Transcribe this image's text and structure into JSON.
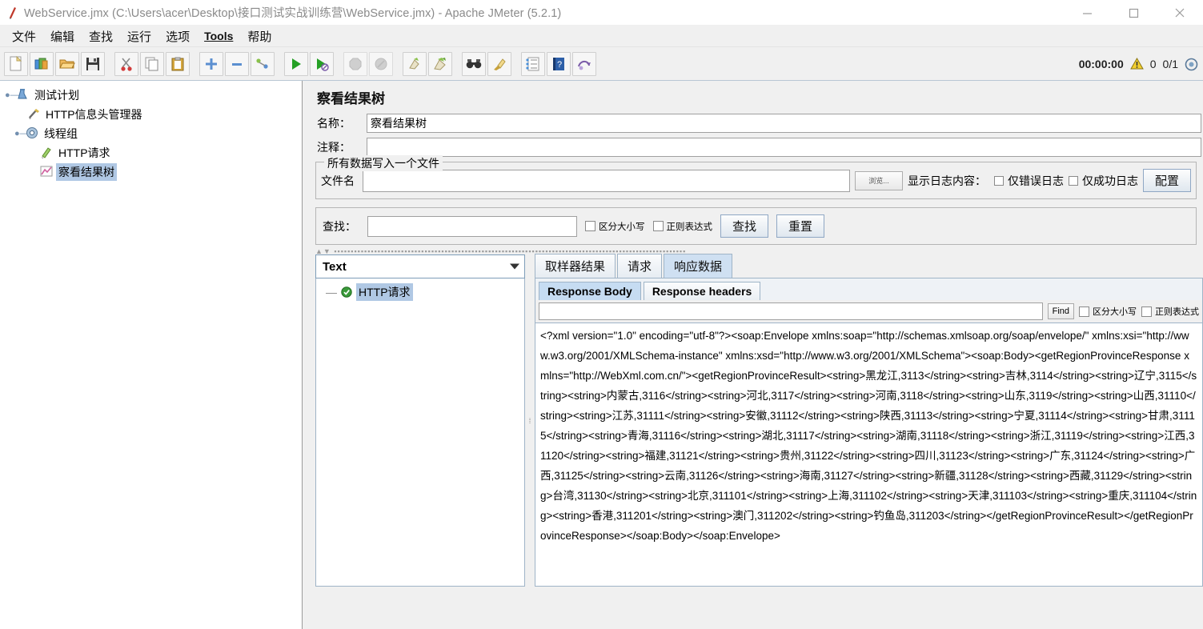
{
  "window": {
    "title": "WebService.jmx (C:\\Users\\acer\\Desktop\\接口测试实战训练营\\WebService.jmx) - Apache JMeter (5.2.1)",
    "app_icon": "jmeter-feather-icon",
    "minimize": "—",
    "maximize": "□",
    "close": "✕"
  },
  "menubar": {
    "items": [
      {
        "label": "文件",
        "underlined": false
      },
      {
        "label": "编辑",
        "underlined": false
      },
      {
        "label": "查找",
        "underlined": false
      },
      {
        "label": "运行",
        "underlined": false
      },
      {
        "label": "选项",
        "underlined": false
      },
      {
        "label": "Tools",
        "underlined": true
      },
      {
        "label": "帮助",
        "underlined": false
      }
    ]
  },
  "toolbar": {
    "buttons": [
      {
        "name": "new-icon"
      },
      {
        "name": "templates-icon"
      },
      {
        "name": "open-icon"
      },
      {
        "name": "save-icon"
      },
      {
        "name": "cut-icon"
      },
      {
        "name": "copy-icon"
      },
      {
        "name": "paste-icon"
      },
      {
        "name": "expand-all-icon"
      },
      {
        "name": "collapse-all-icon"
      },
      {
        "name": "toggle-icon"
      },
      {
        "name": "start-icon"
      },
      {
        "name": "start-no-pauses-icon"
      },
      {
        "name": "stop-icon"
      },
      {
        "name": "shutdown-icon"
      },
      {
        "name": "clear-icon"
      },
      {
        "name": "clear-all-icon"
      },
      {
        "name": "search-icon"
      },
      {
        "name": "search-reset-icon"
      },
      {
        "name": "function-helper-icon"
      },
      {
        "name": "help-icon"
      },
      {
        "name": "undo-icon"
      }
    ],
    "status": {
      "timer": "00:00:00",
      "warning_icon": "warning-triangle-icon",
      "warning_count": "0",
      "threads": "0/1",
      "thread_icon": "thread-count-icon"
    }
  },
  "tree": {
    "nodes": [
      {
        "label": "测试计划",
        "icon": "test-plan-icon",
        "indent": 0,
        "expander": "expanded",
        "selected": false
      },
      {
        "label": "HTTP信息头管理器",
        "icon": "header-manager-icon",
        "indent": 1,
        "expander": "none",
        "selected": false
      },
      {
        "label": "线程组",
        "icon": "thread-group-icon",
        "indent": 1,
        "expander": "expanded",
        "selected": false
      },
      {
        "label": "HTTP请求",
        "icon": "http-request-icon",
        "indent": 2,
        "expander": "none",
        "selected": false
      },
      {
        "label": "察看结果树",
        "icon": "view-results-tree-icon",
        "indent": 2,
        "expander": "none",
        "selected": true
      }
    ]
  },
  "panel": {
    "title": "察看结果树",
    "name_label": "名称：",
    "name_value": "察看结果树",
    "comment_label": "注释：",
    "comment_value": "",
    "file_group": {
      "title": "所有数据写入一个文件",
      "filename_label": "文件名",
      "filename_value": "",
      "browse_label": "浏览...",
      "log_label": "显示日志内容：",
      "errors_only": "仅错误日志",
      "success_only": "仅成功日志",
      "errors_checked": false,
      "success_checked": false,
      "configure_label": "配置"
    },
    "search": {
      "label": "查找：",
      "value": "",
      "case_sensitive_label": "区分大小写",
      "case_sensitive_checked": false,
      "regex_label": "正则表达式",
      "regex_checked": false,
      "find_button": "查找",
      "reset_button": "重置"
    }
  },
  "results": {
    "render_selected": "Text",
    "entries": [
      {
        "label": "HTTP请求",
        "status": "success",
        "selected": true
      }
    ]
  },
  "tabs": {
    "main": [
      {
        "label": "取样器结果",
        "active": false
      },
      {
        "label": "请求",
        "active": false
      },
      {
        "label": "响应数据",
        "active": true
      }
    ],
    "sub": [
      {
        "label": "Response Body",
        "active": true
      },
      {
        "label": "Response headers",
        "active": false
      }
    ]
  },
  "find_bar": {
    "value": "",
    "find_label": "Find",
    "case_sensitive_label": "区分大小写",
    "case_sensitive_checked": false,
    "regex_label": "正则表达式",
    "regex_checked": false
  },
  "response_body": {
    "text": "<?xml version=\"1.0\" encoding=\"utf-8\"?><soap:Envelope xmlns:soap=\"http://schemas.xmlsoap.org/soap/envelope/\" xmlns:xsi=\"http://www.w3.org/2001/XMLSchema-instance\" xmlns:xsd=\"http://www.w3.org/2001/XMLSchema\"><soap:Body><getRegionProvinceResponse xmlns=\"http://WebXml.com.cn/\"><getRegionProvinceResult><string>黑龙江,3113</string><string>吉林,3114</string><string>辽宁,3115</string><string>内蒙古,3116</string><string>河北,3117</string><string>河南,3118</string><string>山东,3119</string><string>山西,31110</string><string>江苏,31111</string><string>安徽,31112</string><string>陕西,31113</string><string>宁夏,31114</string><string>甘肃,31115</string><string>青海,31116</string><string>湖北,31117</string><string>湖南,31118</string><string>浙江,31119</string><string>江西,31120</string><string>福建,31121</string><string>贵州,31122</string><string>四川,31123</string><string>广东,31124</string><string>广西,31125</string><string>云南,31126</string><string>海南,31127</string><string>新疆,31128</string><string>西藏,31129</string><string>台湾,31130</string><string>北京,311101</string><string>上海,311102</string><string>天津,311103</string><string>重庆,311104</string><string>香港,311201</string><string>澳门,311202</string><string>钓鱼岛,311203</string></getRegionProvinceResult></getRegionProvinceResponse></soap:Body></soap:Envelope>"
  },
  "colors": {
    "selection": "#b0c8e4",
    "tab_active": "#cfe0f2",
    "toolbar_bg": "#f0f0f0",
    "warning": "#f0c419",
    "success_green": "#3a9a3a"
  }
}
